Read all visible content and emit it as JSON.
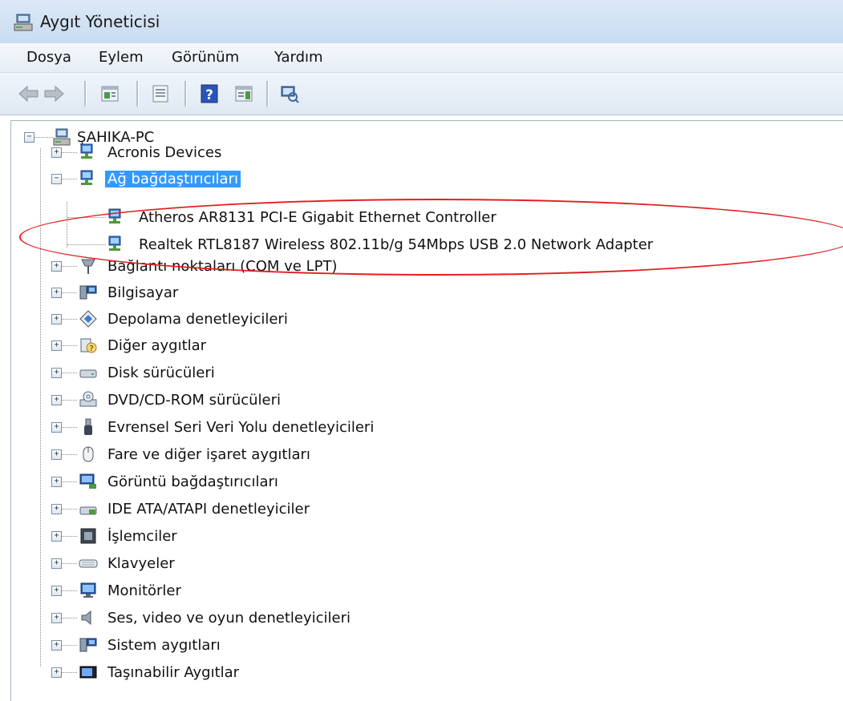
{
  "window": {
    "title": "Aygıt Yöneticisi"
  },
  "menu": [
    "Dosya",
    "Eylem",
    "Görünüm",
    "Yardım"
  ],
  "toolbar": [
    "back-icon",
    "forward-icon",
    "properties-icon",
    "show-hide-icon",
    "help-icon",
    "action-pane-icon",
    "scan-hardware-icon"
  ],
  "tree": {
    "root": "ŞAHIKA-PC",
    "categories": [
      "Acronis Devices",
      "Ağ bağdaştırıcıları",
      "Bağlantı noktaları (COM ve LPT)",
      "Bilgisayar",
      "Depolama denetleyicileri",
      "Diğer aygıtlar",
      "Disk sürücüleri",
      "DVD/CD-ROM sürücüleri",
      "Evrensel Seri Veri Yolu denetleyicileri",
      "Fare ve diğer işaret aygıtları",
      "Görüntü bağdaştırıcıları",
      "IDE ATA/ATAPI denetleyiciler",
      "İşlemciler",
      "Klavyeler",
      "Monitörler",
      "Ses, video ve oyun denetleyicileri",
      "Sistem aygıtları",
      "Taşınabilir Aygıtlar"
    ],
    "network_adapters": [
      "Atheros AR8131 PCI-E Gigabit Ethernet Controller",
      "Realtek RTL8187 Wireless 802.11b/g 54Mbps USB 2.0 Network Adapter"
    ],
    "selected_category": "Ağ bağdaştırıcıları"
  },
  "colors": {
    "selection": "#3399ff",
    "highlight_ellipse": "#e0201f",
    "titlebar": "#c9dcf1"
  }
}
